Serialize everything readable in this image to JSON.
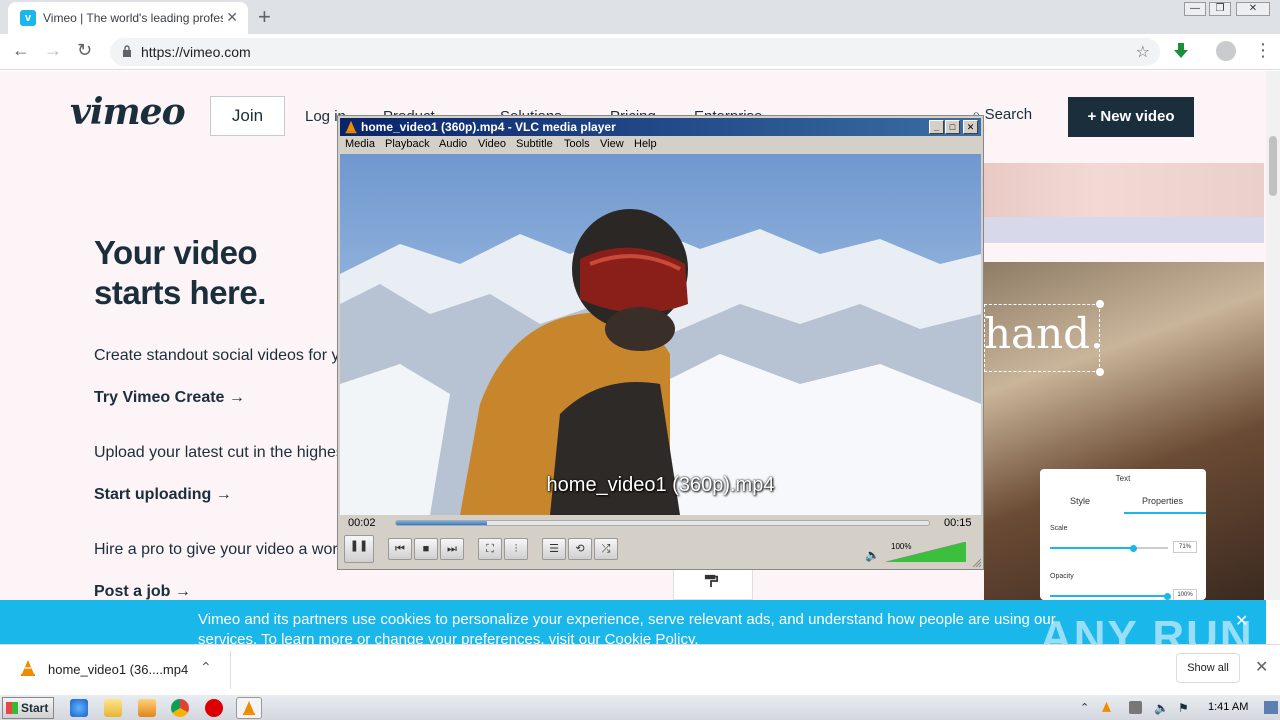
{
  "browser": {
    "tab_title": "Vimeo | The world's leading professio",
    "url": "https://vimeo.com"
  },
  "vimeo": {
    "logo": "vimeo",
    "join": "Join",
    "nav": [
      "Log in",
      "Product",
      "Solutions",
      "Pricing",
      "Enterprise"
    ],
    "search": "Search",
    "new_video": "New video",
    "hero_line1": "Your video",
    "hero_line2": "starts here.",
    "line_create": "Create standout social videos for yo",
    "cta_create": "Try Vimeo Create",
    "line_upload": "Upload your latest cut in the highest",
    "cta_upload": "Start uploading",
    "line_hire": "Hire a pro to give your video a world",
    "cta_hire": "Post a job",
    "image_text": "hand.",
    "panel": {
      "title": "Text",
      "tab_style": "Style",
      "tab_properties": "Properties",
      "scale_label": "Scale",
      "scale_value": "71%",
      "scale_level": 0.71,
      "opacity_label": "Opacity",
      "opacity_value": "100%",
      "opacity_level": 1.0
    }
  },
  "cookie": {
    "text": "Vimeo and its partners use cookies to personalize your experience, serve relevant ads, and understand how people are using our services. To learn more or change your preferences, visit our Cookie Policy."
  },
  "download": {
    "file": "home_video1 (36....mp4",
    "show_all": "Show all"
  },
  "vlc": {
    "title": "home_video1 (360p).mp4 - VLC media player",
    "menu": [
      "Media",
      "Playback",
      "Audio",
      "Video",
      "Subtitle",
      "Tools",
      "View",
      "Help"
    ],
    "subtitle": "home_video1 (360p).mp4",
    "time_elapsed": "00:02",
    "time_total": "00:15",
    "progress": 0.17,
    "volume_label": "100%",
    "volume": 1.0
  },
  "taskbar": {
    "start": "Start",
    "clock": "1:41 AM"
  },
  "watermark": "ANY RUN",
  "colors": {
    "vimeo_blue": "#1ab7ea",
    "vimeo_navy": "#1a2e3b",
    "vlc_title": "#0a246a"
  }
}
